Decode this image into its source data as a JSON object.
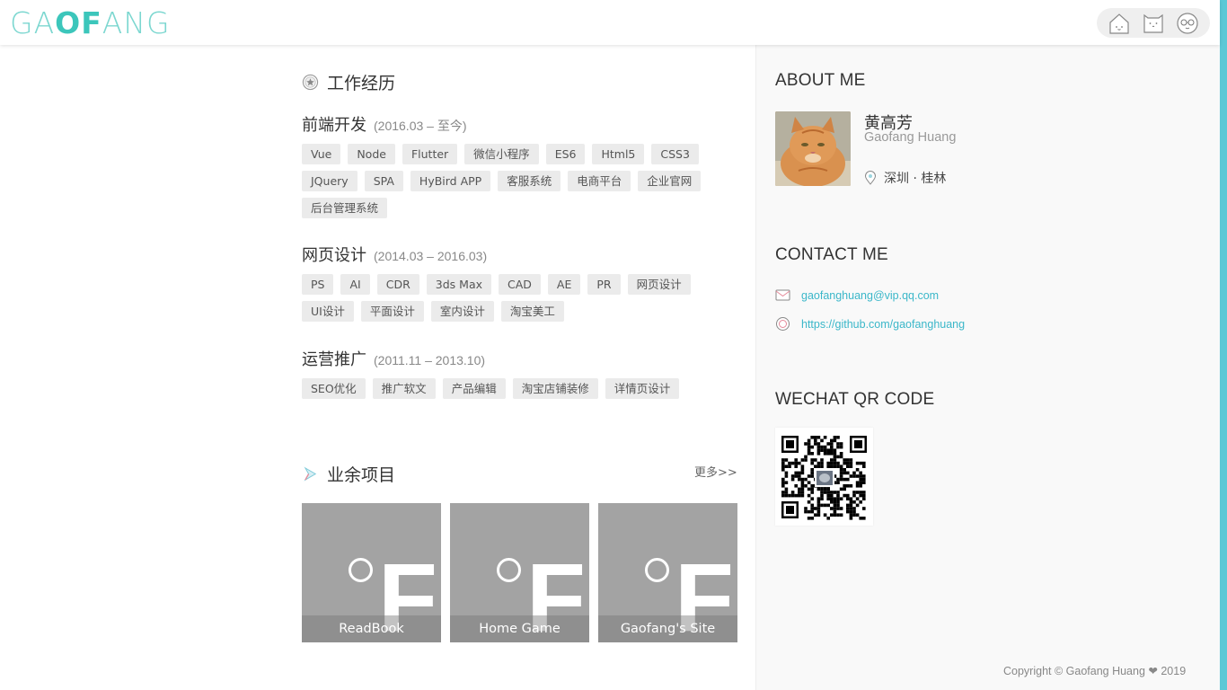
{
  "header": {
    "logo": {
      "part1": "GA",
      "part2": "OF",
      "part3": "ANG"
    },
    "icons": [
      "home-icon",
      "cat-face-icon",
      "glasses-face-icon"
    ]
  },
  "work": {
    "title": "工作经历",
    "jobs": [
      {
        "title": "前端开发",
        "period": "(2016.03 – 至今)",
        "tags": [
          "Vue",
          "Node",
          "Flutter",
          "微信小程序",
          "ES6",
          "Html5",
          "CSS3",
          "JQuery",
          "SPA",
          "HyBird APP",
          "客服系统",
          "电商平台",
          "企业官网",
          "后台管理系统"
        ]
      },
      {
        "title": "网页设计",
        "period": "(2014.03 – 2016.03)",
        "tags": [
          "PS",
          "AI",
          "CDR",
          "3ds Max",
          "CAD",
          "AE",
          "PR",
          "网页设计",
          "UI设计",
          "平面设计",
          "室内设计",
          "淘宝美工"
        ]
      },
      {
        "title": "运营推广",
        "period": "(2011.11 – 2013.10)",
        "tags": [
          "SEO优化",
          "推广软文",
          "产品编辑",
          "淘宝店铺装修",
          "详情页设计"
        ]
      }
    ]
  },
  "projects": {
    "title": "业余项目",
    "more": "更多>>",
    "items": [
      {
        "name": "ReadBook"
      },
      {
        "name": "Home Game"
      },
      {
        "name": "Gaofang's Site"
      }
    ]
  },
  "sidebar": {
    "about_title": "ABOUT ME",
    "name_cn": "黄高芳",
    "name_en": "Gaofang Huang",
    "location": "深圳 · 桂林",
    "contact_title": "CONTACT ME",
    "email": "gaofanghuang@vip.qq.com",
    "github": "https://github.com/gaofanghuang",
    "wechat_title": "WECHAT QR CODE",
    "copyright": "Copyright © Gaofang Huang ❤ 2019"
  },
  "colors": {
    "accent": "#5bc8d6",
    "logo": "#3cc6bb",
    "link": "#3bb7c9",
    "tag_bg": "#ebebeb",
    "card_bg": "#a3a3a3"
  }
}
